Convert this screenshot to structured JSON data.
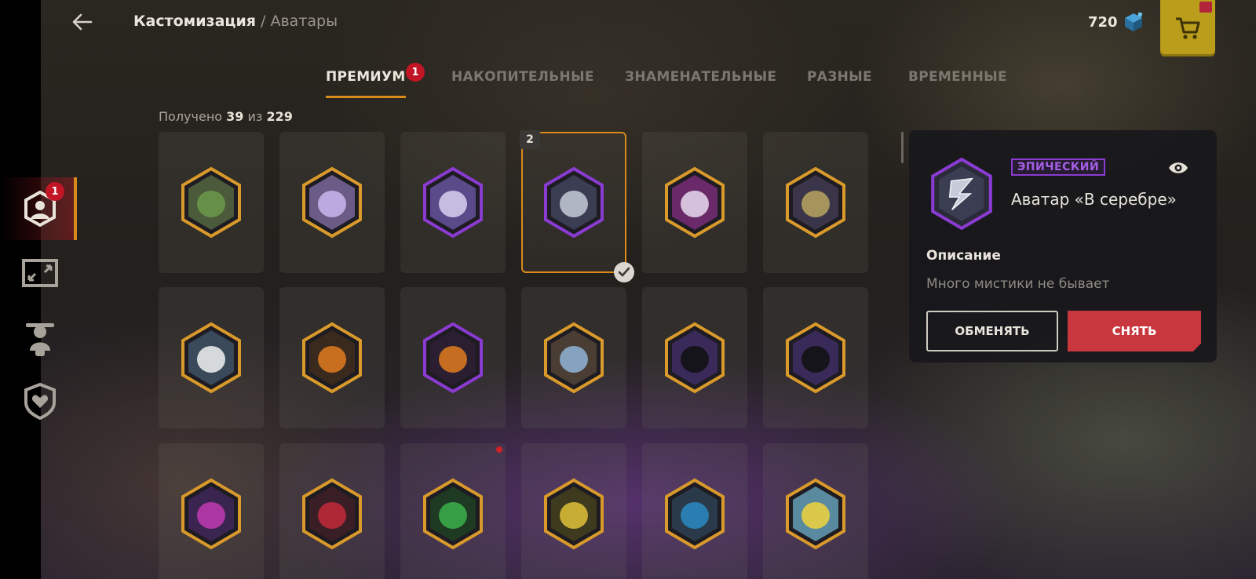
{
  "header": {
    "breadcrumb_root": "Кастомизация",
    "breadcrumb_sep": "/",
    "breadcrumb_current": "Аватары",
    "currency_amount": "720"
  },
  "tabs": [
    {
      "label": "ПРЕМИУМ",
      "active": true
    },
    {
      "label": "НАКОПИТЕЛЬНЫЕ",
      "active": false
    },
    {
      "label": "ЗНАМЕНАТЕЛЬНЫЕ",
      "active": false
    },
    {
      "label": "РАЗНЫЕ",
      "active": false
    },
    {
      "label": "ВРЕМЕННЫЕ",
      "active": false
    }
  ],
  "tab_badge": "1",
  "sidebar": {
    "badge": "1",
    "items": [
      "avatar-icon",
      "frame-icon",
      "character-icon",
      "heart-shield-icon"
    ]
  },
  "counter": {
    "prefix": "Получено",
    "received": "39",
    "of": "из",
    "total": "229"
  },
  "grid": {
    "selected_slot": "2",
    "items": [
      {
        "icon": "turtle-avatar-icon",
        "border": "gold"
      },
      {
        "icon": "lightning-lilac-avatar-icon",
        "border": "gold"
      },
      {
        "icon": "lightning-purple-avatar-icon",
        "border": "purple"
      },
      {
        "icon": "lightning-silver-avatar-icon",
        "border": "purple"
      },
      {
        "icon": "lightning-pixel-avatar-icon",
        "border": "gold"
      },
      {
        "icon": "signpost-avatar-icon",
        "border": "gold"
      },
      {
        "icon": "snowman-avatar-icon",
        "border": "gold"
      },
      {
        "icon": "pumpkin-gold-avatar-icon",
        "border": "gold"
      },
      {
        "icon": "pumpkin-purple-avatar-icon",
        "border": "purple"
      },
      {
        "icon": "crystal-rock-avatar-icon",
        "border": "gold"
      },
      {
        "icon": "black-cat-gold-avatar-icon",
        "border": "gold"
      },
      {
        "icon": "black-cat-purple-avatar-icon",
        "border": "gold"
      },
      {
        "icon": "mushroom-avatar-icon",
        "border": "gold"
      },
      {
        "icon": "rose-avatar-icon",
        "border": "gold"
      },
      {
        "icon": "clover-avatar-icon",
        "border": "gold"
      },
      {
        "icon": "yellow-sub-avatar-icon",
        "border": "gold"
      },
      {
        "icon": "scarab-avatar-icon",
        "border": "gold"
      },
      {
        "icon": "rubber-duck-avatar-icon",
        "border": "gold"
      }
    ]
  },
  "colors": {
    "gold": "#d99a2b",
    "purple": "#8a3bd1",
    "accent": "#d98a1a",
    "danger": "#c9373e"
  },
  "detail": {
    "rarity": "ЭПИЧЕСКИЙ",
    "name": "Аватар «В серебре»",
    "desc_heading": "Описание",
    "desc_text": "Много мистики не бывает",
    "exchange_label": "ОБМЕНЯТЬ",
    "remove_label": "СНЯТЬ"
  }
}
